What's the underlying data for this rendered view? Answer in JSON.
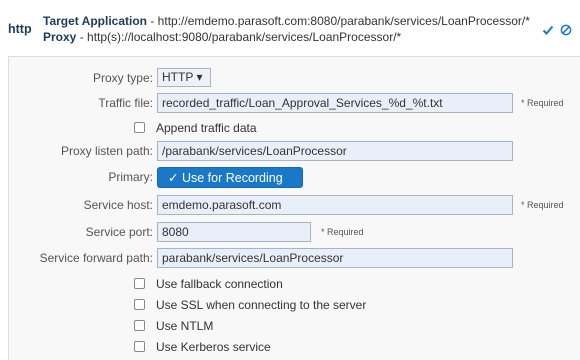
{
  "header": {
    "protocol": "http",
    "target_label": "Target Application",
    "target_value": " - http://emdemo.parasoft.com:8080/parabank/services/LoanProcessor/*",
    "proxy_label": "Proxy",
    "proxy_value": " - http(s)://localhost:9080/parabank/services/LoanProcessor/*",
    "colors": {
      "check": "#1a78c9",
      "disable": "#1a78c9"
    }
  },
  "form": {
    "proxy_type_label": "Proxy type:",
    "proxy_type_value": "HTTP ▾",
    "traffic_file_label": "Traffic file:",
    "traffic_file_value": "recorded_traffic/Loan_Approval_Services_%d_%t.txt",
    "required_text": "* Required",
    "append_label": "Append traffic data",
    "listen_path_label": "Proxy listen path:",
    "listen_path_value": "/parabank/services/LoanProcessor",
    "primary_label": "Primary:",
    "primary_button": "✓ Use for Recording",
    "service_host_label": "Service host:",
    "service_host_value": "emdemo.parasoft.com",
    "service_port_label": "Service port:",
    "service_port_value": "8080",
    "forward_path_label": "Service forward path:",
    "forward_path_value": "parabank/services/LoanProcessor",
    "fallback_label": "Use fallback connection",
    "ssl_label": "Use SSL when connecting to the server",
    "ntlm_label": "Use NTLM",
    "kerberos_label": "Use Kerberos service"
  }
}
